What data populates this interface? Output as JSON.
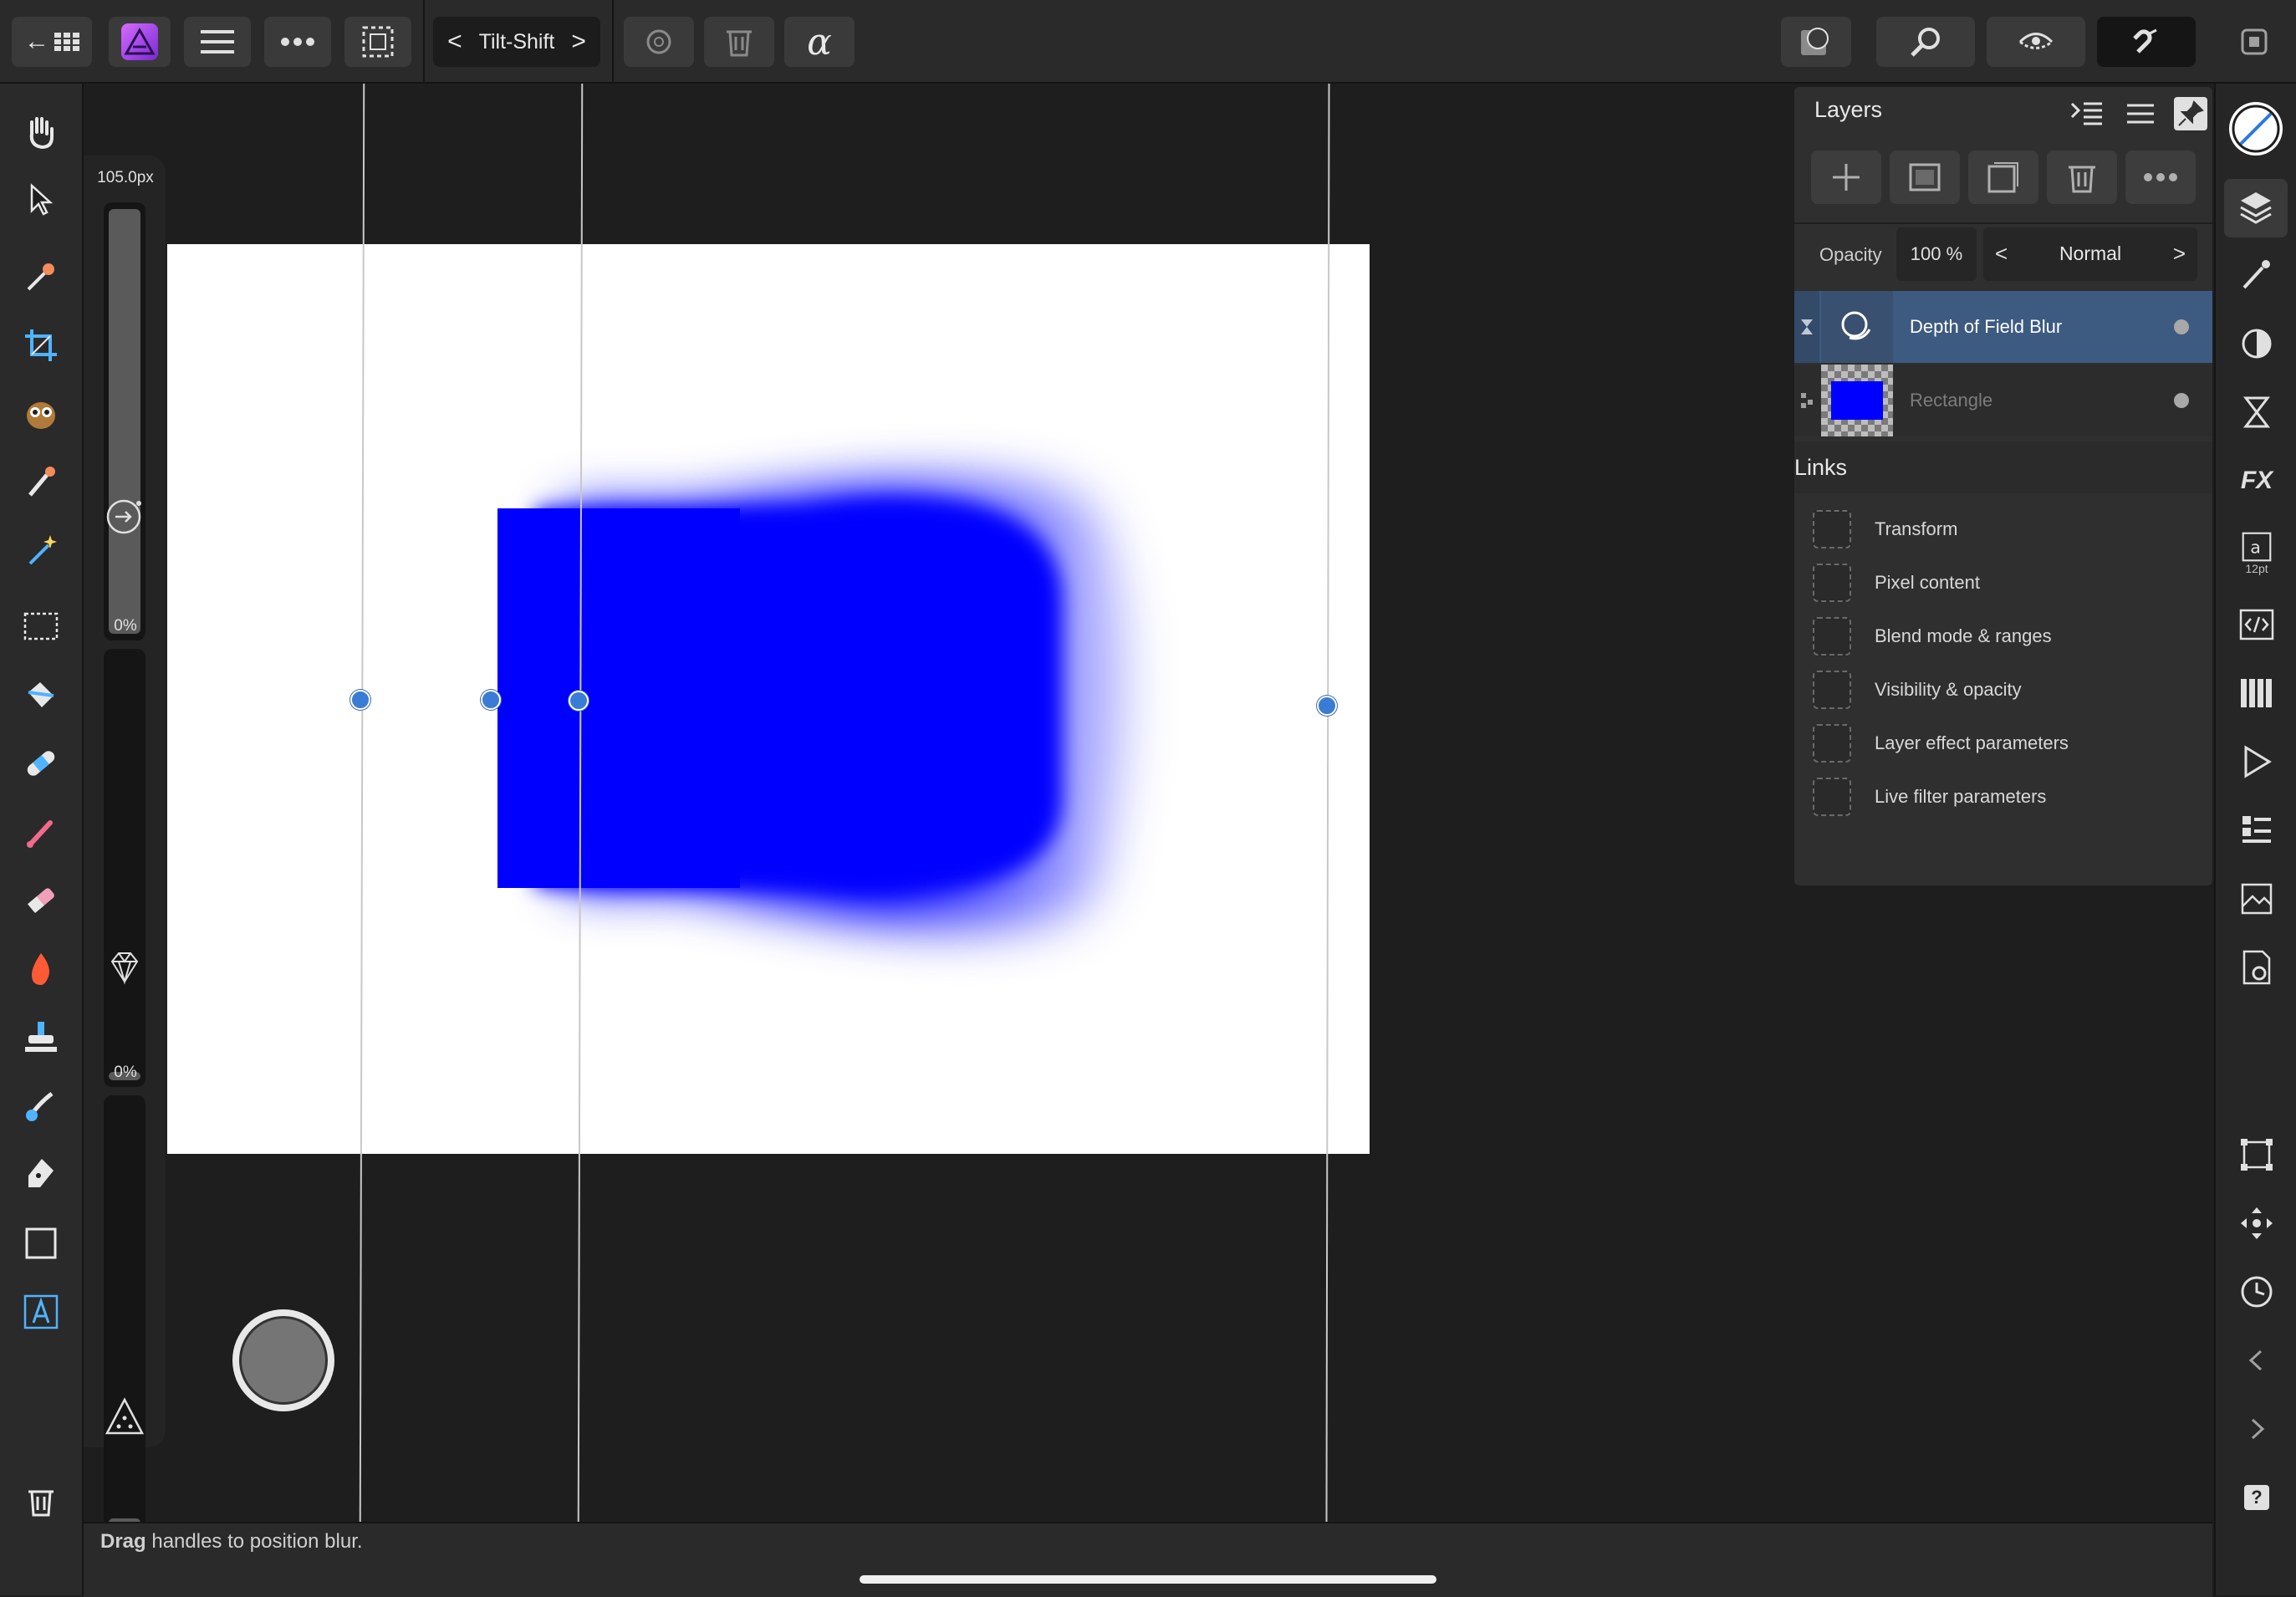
{
  "toolbar": {
    "back_label": "←",
    "persona_label": "Tilt-Shift",
    "prev_label": "<",
    "next_label": ">",
    "alpha_label": "α"
  },
  "context": {
    "width_value": "105.0px",
    "opacity_value": "0%",
    "flow_value": "0%"
  },
  "layers_panel": {
    "title": "Layers",
    "opacity_label": "Opacity",
    "opacity_value": "100 %",
    "blend_mode": "Normal",
    "layers": [
      {
        "name": "Depth of Field Blur",
        "selected": true
      },
      {
        "name": "Rectangle",
        "selected": false,
        "thumb_color": "#0000ff"
      }
    ]
  },
  "links_panel": {
    "title": "Links",
    "items": [
      "Transform",
      "Pixel content",
      "Blend mode & ranges",
      "Visibility & opacity",
      "Layer effect parameters",
      "Live filter parameters"
    ]
  },
  "studio": {
    "text_size_label": "12pt",
    "fx_label": "FX",
    "help_label": "?"
  },
  "status": {
    "bold": "Drag",
    "text": " handles to position blur."
  },
  "colors": {
    "accent": "#3a7bd5",
    "shape": "#0000ff",
    "selected_layer": "#3d5a80"
  }
}
